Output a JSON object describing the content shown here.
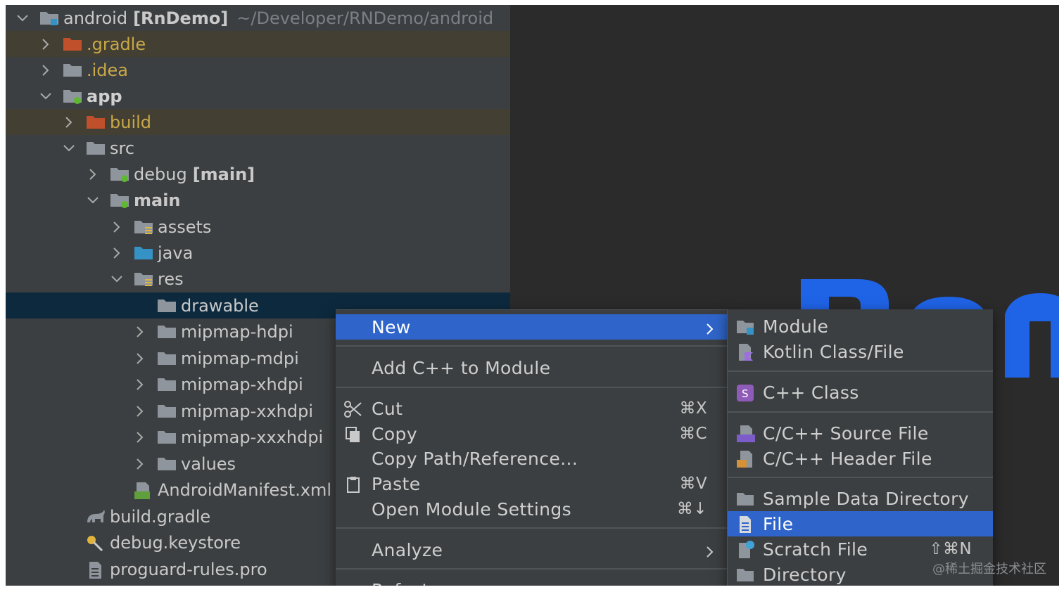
{
  "tree": {
    "root": {
      "name": "android",
      "module": "[RnDemo]",
      "path": "~/Developer/RNDemo/android"
    },
    "items": [
      {
        "label": ".gradle"
      },
      {
        "label": ".idea"
      },
      {
        "label": "app"
      },
      {
        "label": "build"
      },
      {
        "label": "src"
      },
      {
        "label": "debug",
        "tag": "[main]"
      },
      {
        "label": "main"
      },
      {
        "label": "assets"
      },
      {
        "label": "java"
      },
      {
        "label": "res"
      },
      {
        "label": "drawable"
      },
      {
        "label": "mipmap-hdpi"
      },
      {
        "label": "mipmap-mdpi"
      },
      {
        "label": "mipmap-xhdpi"
      },
      {
        "label": "mipmap-xxhdpi"
      },
      {
        "label": "mipmap-xxxhdpi"
      },
      {
        "label": "values"
      },
      {
        "label": "AndroidManifest.xml"
      },
      {
        "label": "build.gradle"
      },
      {
        "label": "debug.keystore"
      },
      {
        "label": "proguard-rules.pro"
      }
    ]
  },
  "context_menu": {
    "new": "New",
    "add_cpp": "Add C++ to Module",
    "cut": "Cut",
    "cut_key": "⌘X",
    "copy": "Copy",
    "copy_key": "⌘C",
    "copy_path": "Copy Path/Reference...",
    "paste": "Paste",
    "paste_key": "⌘V",
    "open_module_settings": "Open Module Settings",
    "oms_key": "⌘↓",
    "analyze": "Analyze",
    "refactor": "Refactor"
  },
  "submenu": {
    "module": "Module",
    "kotlin": "Kotlin Class/File",
    "cpp_class": "C++ Class",
    "cpp_source": "C/C++ Source File",
    "cpp_header": "C/C++ Header File",
    "sample_data": "Sample Data Directory",
    "file": "File",
    "scratch": "Scratch File",
    "scratch_key": "⇧⌘N",
    "directory": "Directory"
  },
  "watermark": "@稀土掘金技术社区",
  "colors": {
    "selection": "#2f65ca",
    "excluded_folder": "#c8a848",
    "module_dot": "#5fb832"
  }
}
